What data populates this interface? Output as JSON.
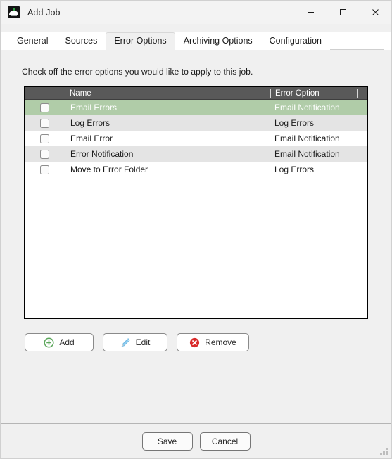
{
  "window": {
    "title": "Add Job",
    "icon": "app-dome-icon",
    "controls": {
      "minimize": "minimize-icon",
      "maximize": "maximize-icon",
      "close": "close-icon"
    }
  },
  "tabs": [
    {
      "label": "General",
      "active": false
    },
    {
      "label": "Sources",
      "active": false
    },
    {
      "label": "Error Options",
      "active": true
    },
    {
      "label": "Archiving Options",
      "active": false
    },
    {
      "label": "Configuration",
      "active": false
    }
  ],
  "main": {
    "hint": "Check off the error options you would like to apply to this job.",
    "table": {
      "columns": [
        "",
        "Name",
        "Error Option",
        ""
      ],
      "rows": [
        {
          "checked": false,
          "name": "Email Errors",
          "option": "Email Notification",
          "style": "selected"
        },
        {
          "checked": false,
          "name": "Log Errors",
          "option": "Log Errors",
          "style": "alt"
        },
        {
          "checked": false,
          "name": "Email Error",
          "option": "Email Notification",
          "style": "plain"
        },
        {
          "checked": false,
          "name": "Error Notification",
          "option": "Email Notification",
          "style": "alt"
        },
        {
          "checked": false,
          "name": "Move to Error Folder",
          "option": "Log Errors",
          "style": "plain"
        }
      ]
    },
    "actions": [
      {
        "label": "Add",
        "icon": "plus-circle-icon",
        "color": "#5ca75c"
      },
      {
        "label": "Edit",
        "icon": "pencil-icon",
        "color": "#7fc2ec"
      },
      {
        "label": "Remove",
        "icon": "x-circle-icon",
        "color": "#d92b2b"
      }
    ]
  },
  "footer": {
    "save_label": "Save",
    "cancel_label": "Cancel"
  },
  "colors": {
    "header_bg": "#595959",
    "selected_row": "#b0cca8",
    "alt_row": "#e4e4e4",
    "accent_add": "#5ca75c",
    "accent_edit": "#7fc2ec",
    "accent_remove": "#d92b2b"
  }
}
